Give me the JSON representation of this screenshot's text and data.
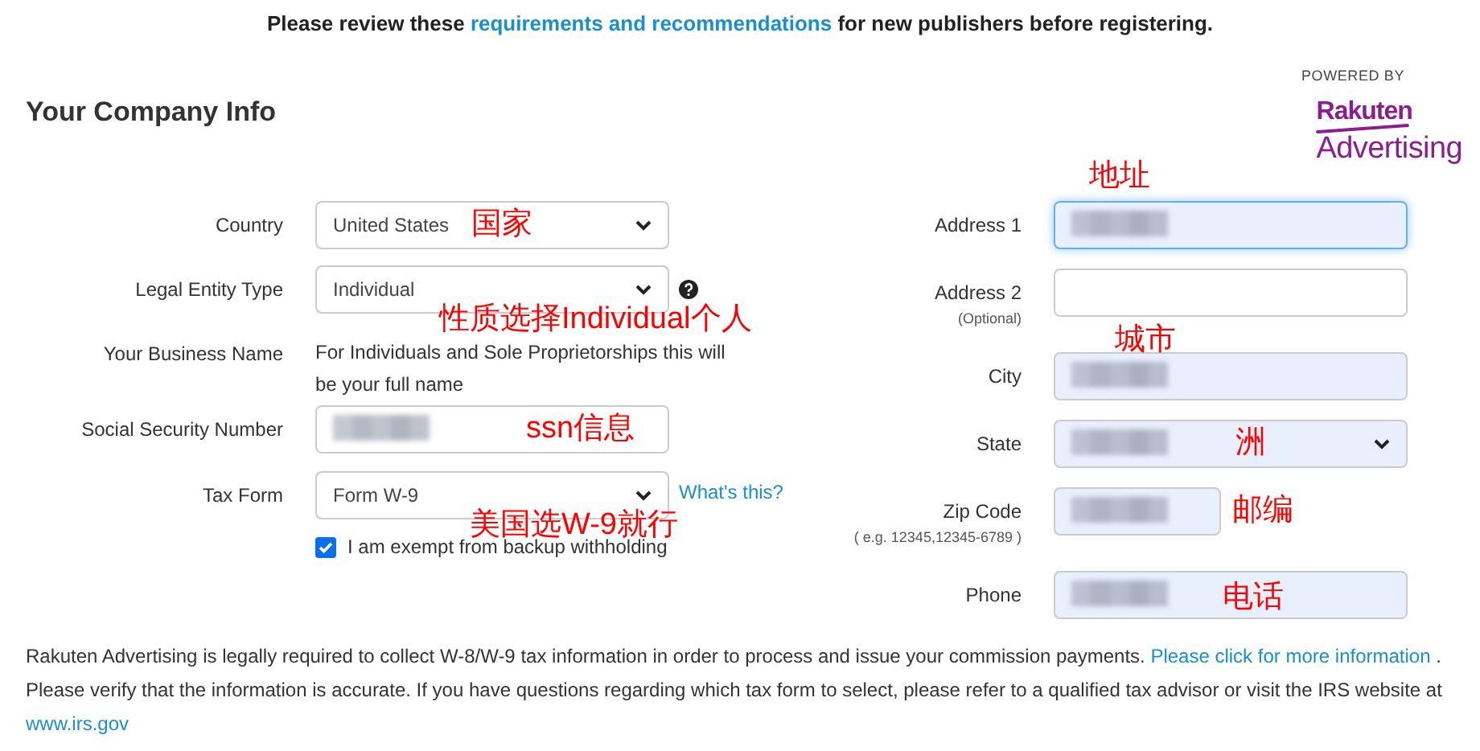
{
  "notice": {
    "before": "Please review these",
    "link": "requirements and recommendations",
    "after": "for new publishers before registering."
  },
  "title": "Your Company Info",
  "brand": {
    "powered_by": "POWERED BY",
    "logo_top": "Rakuten",
    "logo_bottom": "Advertising"
  },
  "left_fields": [
    {
      "label": "Country",
      "kind": "select",
      "value": "United States"
    },
    {
      "label": "Legal Entity Type",
      "kind": "select",
      "value": "Individual",
      "help_icon": true
    },
    {
      "label": "Your Business Name",
      "kind": "note",
      "value": "For Individuals and Sole Proprietorships this will be your full name"
    },
    {
      "label": "Social Security Number",
      "kind": "text",
      "redacted": true,
      "autofilled": false
    },
    {
      "label": "Tax Form",
      "kind": "select",
      "value": "Form W-9",
      "link": "What's this?"
    }
  ],
  "exempt_checkbox": {
    "label": "I am exempt from backup withholding",
    "checked": true
  },
  "right_fields": [
    {
      "label": "Address 1",
      "kind": "text",
      "redacted": true,
      "autofilled": true,
      "focused": true
    },
    {
      "label": "Address 2",
      "sublabel": "(Optional)",
      "kind": "text",
      "redacted": false,
      "autofilled": false,
      "focused": false
    },
    {
      "label": "City",
      "kind": "text",
      "redacted": true,
      "autofilled": true,
      "focused": false
    },
    {
      "label": "State",
      "kind": "select",
      "redacted": true,
      "autofilled": true
    },
    {
      "label": "Zip Code",
      "sublabel": "( e.g. 12345,12345-6789 )",
      "kind": "short",
      "redacted": true,
      "autofilled": true,
      "focused": false
    },
    {
      "label": "Phone",
      "kind": "text",
      "redacted": true,
      "autofilled": true,
      "focused": false
    }
  ],
  "footer": {
    "text": "Rakuten Advertising is legally required to collect W-8/W-9 tax information in order to process and issue your commission payments.",
    "link": "Please click for more information",
    "after": ".",
    "text2": "Please verify that the information is accurate. If you have questions regarding which tax form to select, please refer to a qualified tax advisor or visit the IRS website at",
    "link2": "www.irs.gov"
  },
  "annotations": [
    {
      "text": "国家",
      "color": "#ff0000"
    },
    {
      "text": "性质选择Individual个人",
      "color": "#ff0000"
    },
    {
      "text": "ssn信息",
      "color": "#ff0000"
    },
    {
      "text": "美国选W-9就行",
      "color": "#ff0000"
    },
    {
      "text": "地址",
      "color": "#ff0000"
    },
    {
      "text": "城市",
      "color": "#ff0000"
    },
    {
      "text": "洲",
      "color": "#ff0000"
    },
    {
      "text": "邮编",
      "color": "#ff0000"
    },
    {
      "text": "电话",
      "color": "#ff0000"
    }
  ]
}
